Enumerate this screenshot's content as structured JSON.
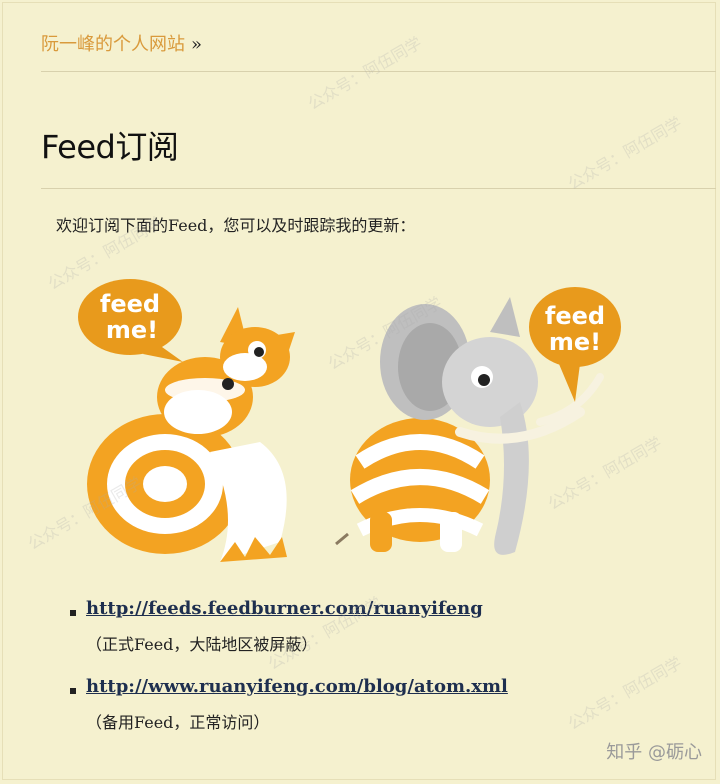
{
  "header": {
    "site_link": "阮一峰的个人网站",
    "separator": "»"
  },
  "main": {
    "title": "Feed订阅",
    "intro": "欢迎订阅下面的Feed，您可以及时跟踪我的更新：",
    "illustration": {
      "bubble_left": [
        "feed",
        "me!"
      ],
      "bubble_right": [
        "feed",
        "me!"
      ]
    },
    "feeds": [
      {
        "url": "http://feeds.feedburner.com/ruanyifeng",
        "note": "（正式Feed，大陆地区被屏蔽）"
      },
      {
        "url": "http://www.ruanyifeng.com/blog/atom.xml",
        "note": "（备用Feed，正常访问）"
      }
    ]
  },
  "watermark": {
    "text": "公众号：阿伍同学",
    "brand": "知乎 @砺心"
  },
  "colors": {
    "background": "#f5f1cf",
    "breadcrumb": "#d99a3c",
    "link": "#1e2f4f",
    "orange": "#f0a21f"
  }
}
